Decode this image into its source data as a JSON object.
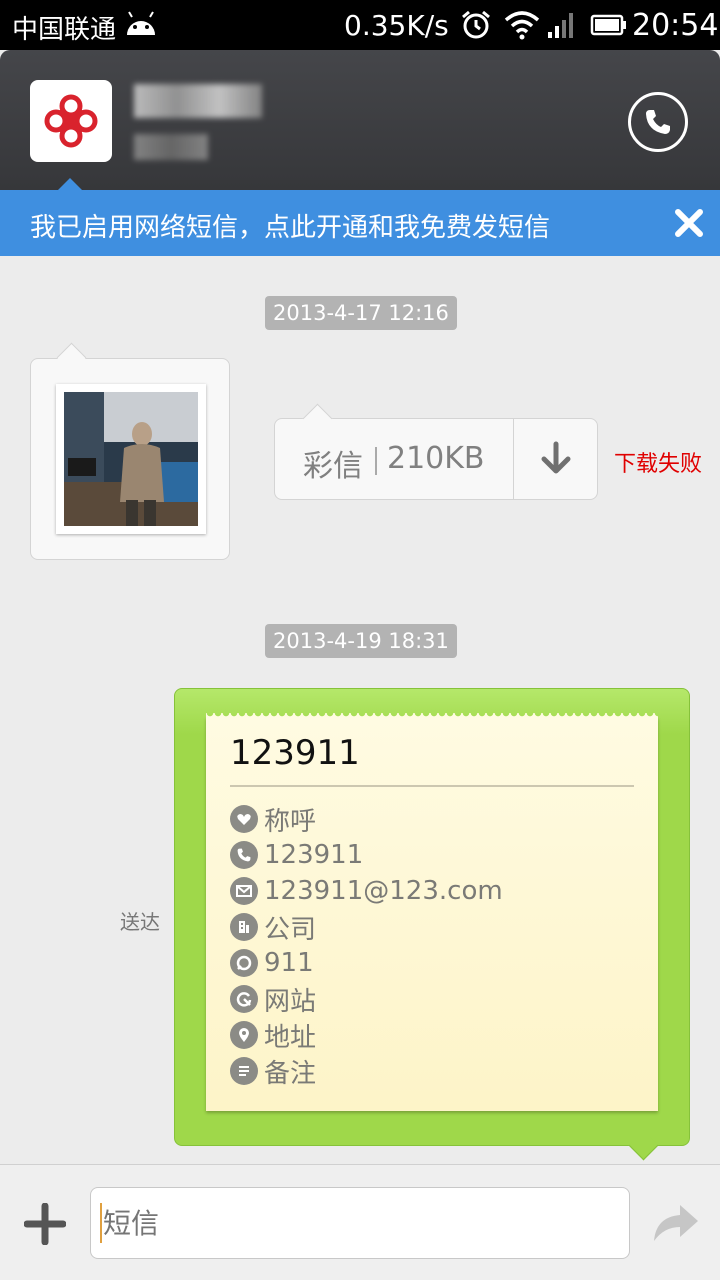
{
  "status_bar": {
    "carrier": "中国联通",
    "speed": "0.35K/s",
    "time": "20:54"
  },
  "header": {
    "contact_avatar": "china-unicom-logo",
    "call_icon": "phone-icon"
  },
  "banner": {
    "text": "我已启用网络短信，点此开通和我免费发短信"
  },
  "messages": [
    {
      "timestamp": "2013-4-17 12:16",
      "mms": {
        "label": "彩信",
        "size": "210KB",
        "status": "下载失败"
      }
    },
    {
      "timestamp": "2013-4-19 18:31",
      "sent_status": "送达",
      "vcard": {
        "name": "123911",
        "rows": [
          {
            "icon": "heart-icon",
            "value": "称呼"
          },
          {
            "icon": "phone-icon",
            "value": "123911"
          },
          {
            "icon": "mail-icon",
            "value": "123911@123.com"
          },
          {
            "icon": "building-icon",
            "value": "公司"
          },
          {
            "icon": "chat-icon",
            "value": "911"
          },
          {
            "icon": "globe-icon",
            "value": "网站"
          },
          {
            "icon": "location-icon",
            "value": "地址"
          },
          {
            "icon": "note-icon",
            "value": "备注"
          }
        ]
      }
    }
  ],
  "composer": {
    "placeholder": "短信"
  },
  "colors": {
    "banner": "#3f8fe0",
    "bubble_green": "#9fd84a",
    "fail_red": "#e00000"
  }
}
